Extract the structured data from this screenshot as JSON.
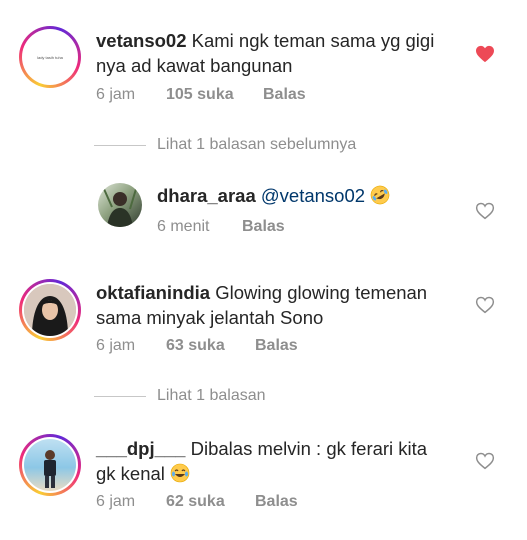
{
  "comments": [
    {
      "username": "vetanso02",
      "text": "Kami ngk teman sama yg gigi nya ad kawat bangunan",
      "line1": "Kami ngk teman sama yg gigi",
      "line2": "nya ad kawat bangunan",
      "time": "6 jam",
      "likes": "105 suka",
      "reply": "Balas",
      "liked": true,
      "avatar_text": "lady tasih tuha"
    },
    {
      "username": "dhara_araa",
      "mention": "@vetanso02",
      "emoji": "rolling-on-floor-laughing",
      "time": "6 menit",
      "reply": "Balas",
      "liked": false
    },
    {
      "username": "oktafianindia",
      "line1": "Glowing glowing temenan",
      "line2": "sama minyak jelantah Sono",
      "time": "6 jam",
      "likes": "63 suka",
      "reply": "Balas",
      "liked": false
    },
    {
      "username": "___dpj___",
      "line1": "Dibalas melvin : gk ferari kita",
      "line2": "gk kenal",
      "emoji": "tears-of-joy",
      "time": "6 jam",
      "likes": "62 suka",
      "reply": "Balas",
      "liked": false
    }
  ],
  "view_replies": [
    {
      "label": "Lihat 1 balasan sebelumnya"
    },
    {
      "label": "Lihat 1 balasan"
    }
  ],
  "colors": {
    "liked_heart": "#ed4956",
    "muted_text": "#8e8e8e",
    "mention": "#00376b"
  }
}
